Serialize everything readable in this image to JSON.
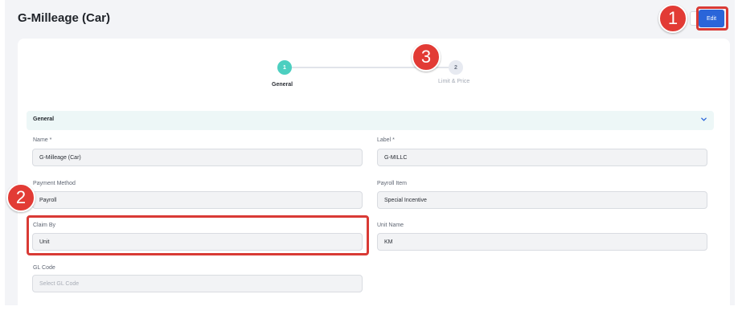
{
  "header": {
    "title": "G-Milleage (Car)",
    "edit_label": "Edit"
  },
  "stepper": {
    "steps": [
      {
        "number": "1",
        "label": "General",
        "active": true
      },
      {
        "number": "2",
        "label": "Limit & Price",
        "active": false
      }
    ]
  },
  "section": {
    "title": "General",
    "icon": "chevron-down-icon"
  },
  "fields": {
    "name": {
      "label": "Name *",
      "value": "G-Milleage (Car)"
    },
    "label": {
      "label": "Label *",
      "value": "G-MILLC"
    },
    "payment_method": {
      "label": "Payment Method",
      "value": "Payroll"
    },
    "payroll_item": {
      "label": "Payroll Item",
      "value": "Special Incentive"
    },
    "claim_by": {
      "label": "Claim By",
      "value": "Unit"
    },
    "unit_name": {
      "label": "Unit Name",
      "value": "KM"
    },
    "gl_code": {
      "label": "GL Code",
      "placeholder": "Select GL Code"
    }
  },
  "annotations": {
    "markers": [
      "1",
      "2",
      "3"
    ],
    "color": "#e23b35"
  },
  "colors": {
    "primary": "#2a65d9",
    "step_active": "#4ccfc0",
    "section_bg": "#edf7f7"
  }
}
